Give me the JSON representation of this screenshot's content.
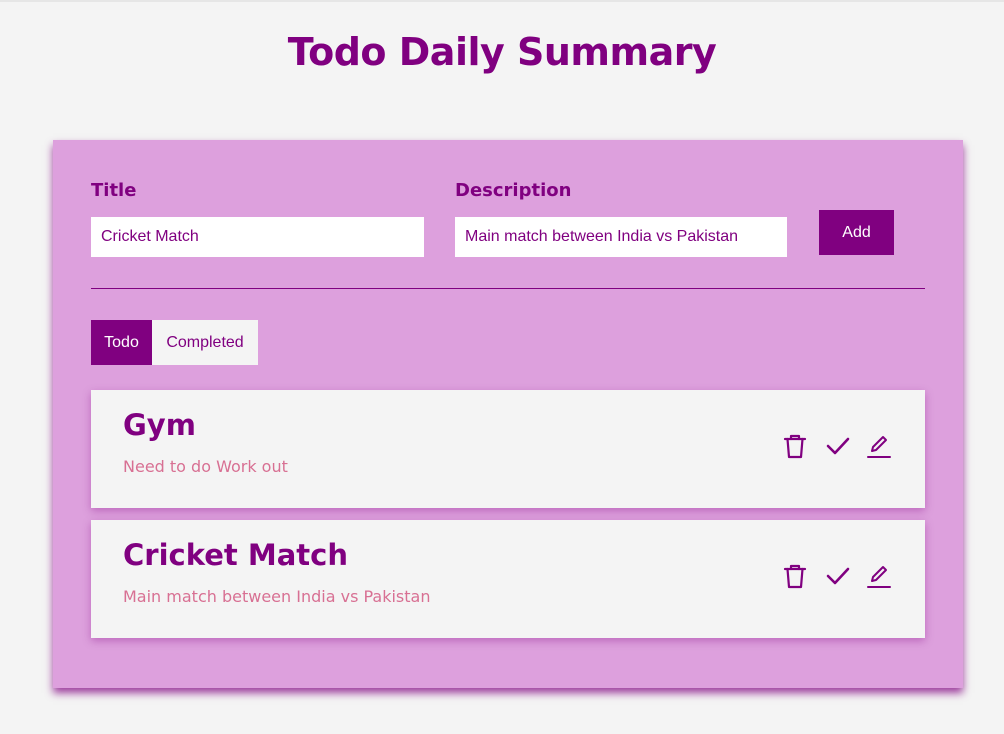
{
  "page": {
    "title": "Todo Daily Summary"
  },
  "form": {
    "title_label": "Title",
    "title_value": "Cricket Match",
    "description_label": "Description",
    "description_value": "Main match between India vs Pakistan",
    "add_label": "Add"
  },
  "tabs": [
    {
      "label": "Todo",
      "active": true
    },
    {
      "label": "Completed",
      "active": false
    }
  ],
  "todos": [
    {
      "title": "Gym",
      "description": "Need to do Work out"
    },
    {
      "title": "Cricket Match",
      "description": "Main match between India vs Pakistan"
    }
  ],
  "item_actions": [
    "delete-icon",
    "check-icon",
    "edit-icon"
  ],
  "colors": {
    "primary": "#800080",
    "panel": "#dda0dd",
    "description": "#d87093",
    "background": "#f4f4f4"
  }
}
